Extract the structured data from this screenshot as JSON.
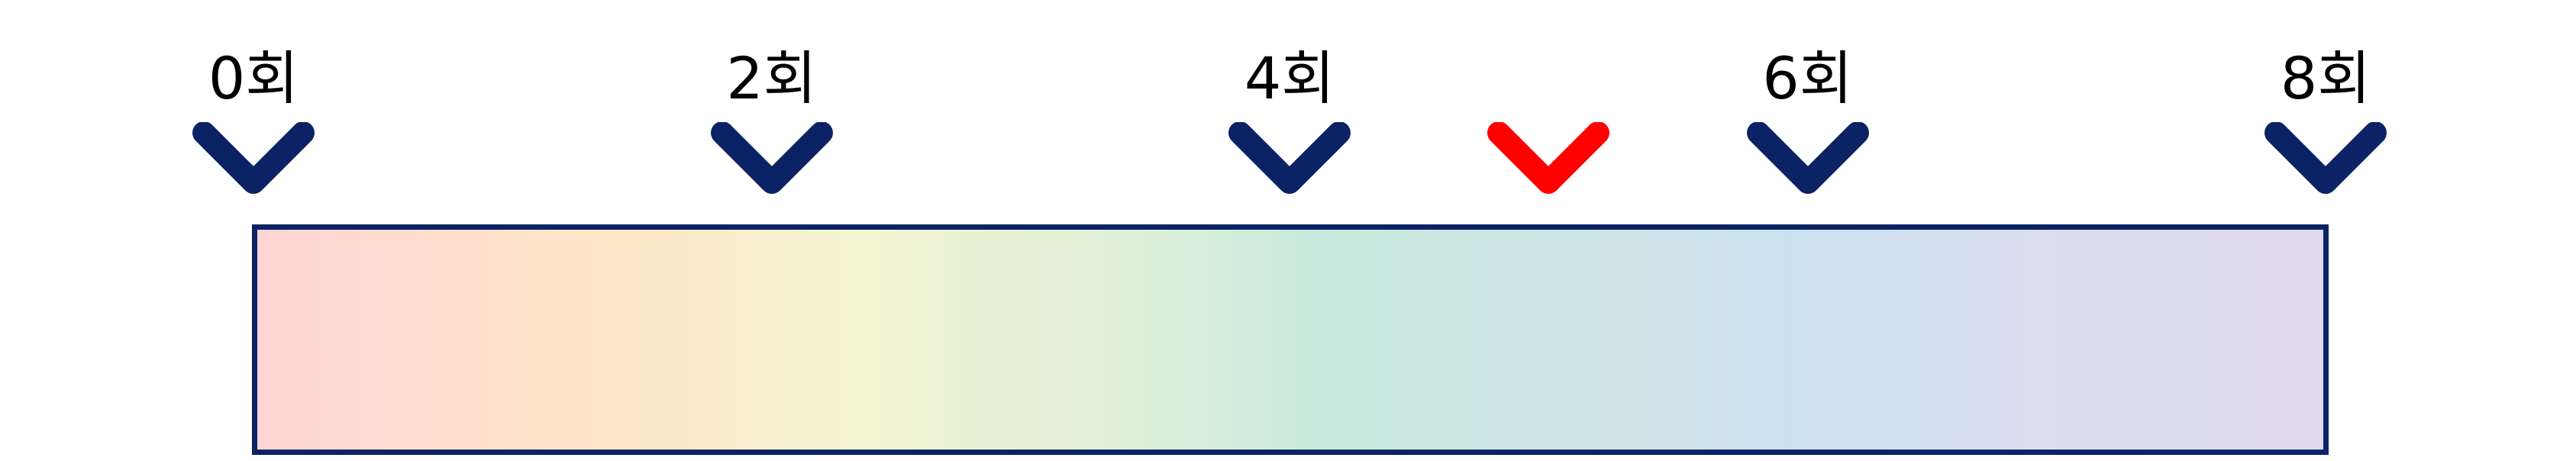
{
  "scale": {
    "min": 0,
    "max": 8,
    "ticks": [
      {
        "value": 0,
        "label": "0회"
      },
      {
        "value": 2,
        "label": "2회"
      },
      {
        "value": 4,
        "label": "4회"
      },
      {
        "value": 6,
        "label": "6회"
      },
      {
        "value": 8,
        "label": "8회"
      }
    ],
    "marker": {
      "value": 5
    },
    "colors": {
      "tick_chevron": "#0b2364",
      "marker_chevron": "#ff0000",
      "bar_border": "#0b2364",
      "gradient_stops": [
        "#ffd4d4",
        "#ffe8c8",
        "#f3f4d2",
        "#dff0d8",
        "#c9eadd",
        "#cfe5e8",
        "#cbe0f0",
        "#dbdff0",
        "#e0d9ee"
      ]
    },
    "icons": {
      "tick": "chevron-down-icon",
      "marker": "chevron-down-icon"
    }
  }
}
